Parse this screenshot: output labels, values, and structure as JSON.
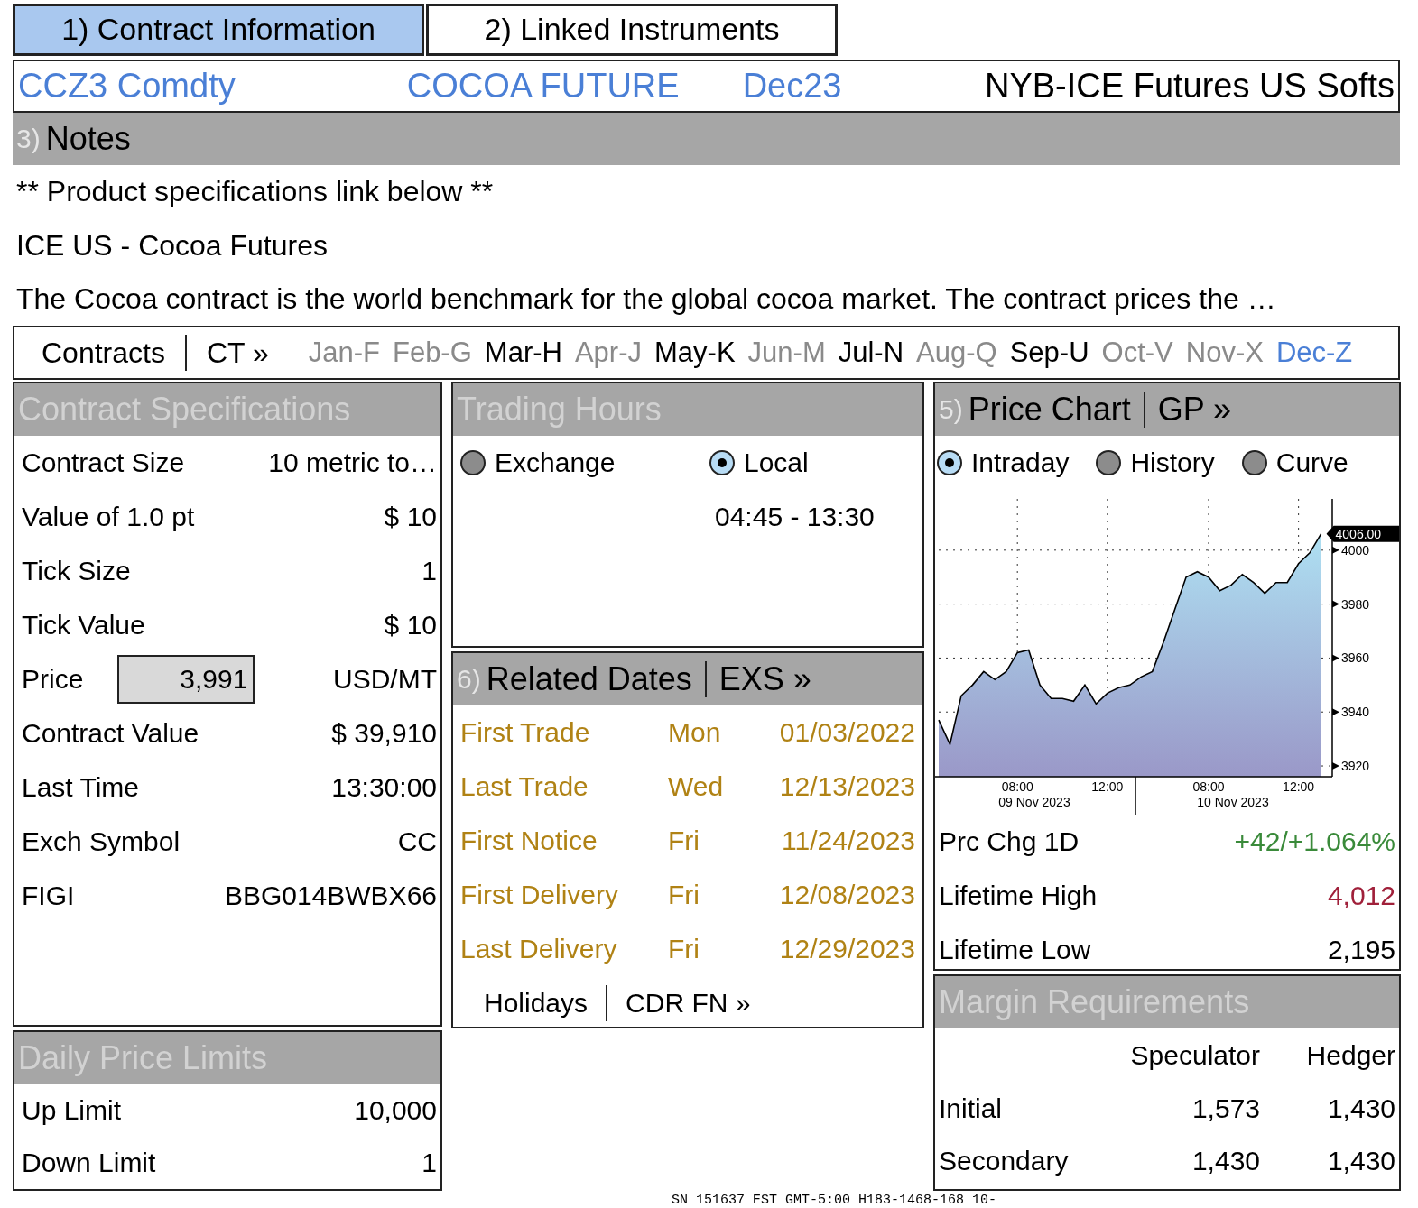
{
  "tabs": [
    {
      "label": "1) Contract Information",
      "selected": true
    },
    {
      "label": "2) Linked Instruments",
      "selected": false
    }
  ],
  "header": {
    "ticker": "CCZ3 Comdty",
    "name": "COCOA FUTURE",
    "month": "Dec23",
    "exchange": "NYB-ICE Futures US Softs"
  },
  "notes": {
    "number": "3)",
    "title": "Notes",
    "lines": [
      "** Product specifications link below **",
      "ICE US - Cocoa Futures",
      "The Cocoa contract is the world benchmark for the global cocoa market. The contract prices the …"
    ]
  },
  "contracts_bar": {
    "label": "Contracts",
    "code": "CT »",
    "months": [
      {
        "label": "Jan-F",
        "available": false,
        "selected": false
      },
      {
        "label": "Feb-G",
        "available": false,
        "selected": false
      },
      {
        "label": "Mar-H",
        "available": true,
        "selected": false
      },
      {
        "label": "Apr-J",
        "available": false,
        "selected": false
      },
      {
        "label": "May-K",
        "available": true,
        "selected": false
      },
      {
        "label": "Jun-M",
        "available": false,
        "selected": false
      },
      {
        "label": "Jul-N",
        "available": true,
        "selected": false
      },
      {
        "label": "Aug-Q",
        "available": false,
        "selected": false
      },
      {
        "label": "Sep-U",
        "available": true,
        "selected": false
      },
      {
        "label": "Oct-V",
        "available": false,
        "selected": false
      },
      {
        "label": "Nov-X",
        "available": false,
        "selected": false
      },
      {
        "label": "Dec-Z",
        "available": true,
        "selected": true
      }
    ]
  },
  "contract_specifications": {
    "title": "Contract Specifications",
    "rows": [
      {
        "kind": "text",
        "label": "Contract Size",
        "value": "10 metric to…"
      },
      {
        "kind": "text",
        "label": "Value of 1.0 pt",
        "value": "$ 10"
      },
      {
        "kind": "text",
        "label": "Tick Size",
        "value": "1"
      },
      {
        "kind": "text",
        "label": "Tick Value",
        "value": "$ 10"
      },
      {
        "kind": "field",
        "label": "Price",
        "value": "3,991",
        "unit": "USD/MT"
      },
      {
        "kind": "text",
        "label": "Contract Value",
        "value": "$ 39,910"
      },
      {
        "kind": "text",
        "label": "Last Time",
        "value": "13:30:00"
      },
      {
        "kind": "text",
        "label": "Exch Symbol",
        "value": "CC"
      },
      {
        "kind": "text",
        "label": "FIGI",
        "value": "BBG014BWBX66"
      }
    ]
  },
  "daily_price_limits": {
    "title": "Daily Price Limits",
    "rows": [
      {
        "label": "Up Limit",
        "value": "10,000"
      },
      {
        "label": "Down Limit",
        "value": "1"
      }
    ]
  },
  "trading_hours": {
    "title": "Trading Hours",
    "options": [
      {
        "label": "Exchange",
        "selected": false
      },
      {
        "label": "Local",
        "selected": true
      }
    ],
    "hours": "04:45 - 13:30"
  },
  "related_dates": {
    "number": "6)",
    "title": "Related Dates",
    "code": "EXS »",
    "rows": [
      {
        "label": "First Trade",
        "day": "Mon",
        "date": "01/03/2022"
      },
      {
        "label": "Last Trade",
        "day": "Wed",
        "date": "12/13/2023"
      },
      {
        "label": "First Notice",
        "day": "Fri",
        "date": "11/24/2023"
      },
      {
        "label": "First Delivery",
        "day": "Fri",
        "date": "12/08/2023"
      },
      {
        "label": "Last Delivery",
        "day": "Fri",
        "date": "12/29/2023"
      }
    ],
    "footer": {
      "label": "Holidays",
      "code": "CDR FN »"
    }
  },
  "price_chart": {
    "number": "5)",
    "title": "Price Chart",
    "code": "GP »",
    "modes": [
      {
        "label": "Intraday",
        "selected": true
      },
      {
        "label": "History",
        "selected": false
      },
      {
        "label": "Curve",
        "selected": false
      }
    ],
    "date_labels": [
      "09 Nov 2023",
      "10 Nov 2023"
    ],
    "chart_data": {
      "type": "area",
      "categories": [
        null,
        null,
        null,
        null,
        null,
        null,
        null,
        "08:00",
        null,
        null,
        null,
        null,
        null,
        null,
        null,
        "12:00",
        null,
        null,
        null,
        null,
        null,
        null,
        null,
        null,
        "08:00",
        null,
        null,
        null,
        null,
        null,
        null,
        null,
        "12:00",
        null,
        null
      ],
      "series": [
        {
          "color": "#000000",
          "values": [
            3937,
            3928,
            3946,
            3950,
            3955,
            3952,
            3955,
            3962,
            3963,
            3950,
            3945,
            3945,
            3944,
            3950,
            3943,
            3947,
            3949,
            3950,
            3953,
            3955,
            3966,
            3978,
            3990,
            3992,
            3990,
            3985,
            3987,
            3991,
            3988,
            3984,
            3988,
            3988,
            3995,
            3999,
            4006
          ]
        }
      ],
      "ylim": [
        3916,
        4019
      ],
      "yticks": [
        3920,
        3940,
        3960,
        3980,
        4000
      ],
      "grid": true,
      "annotations": [
        "4006.00"
      ]
    },
    "stats": [
      {
        "label": "Prc Chg 1D",
        "value": "+42/+1.064%",
        "color": "#3a8a3a"
      },
      {
        "label": "Lifetime High",
        "value": "4,012",
        "color": "#a0203a"
      },
      {
        "label": "Lifetime Low",
        "value": "2,195",
        "color": "#000000"
      }
    ]
  },
  "margin_requirements": {
    "title": "Margin Requirements",
    "columns": [
      "Speculator",
      "Hedger"
    ],
    "rows": [
      {
        "label": "Initial",
        "values": [
          "1,573",
          "1,430"
        ]
      },
      {
        "label": "Secondary",
        "values": [
          "1,430",
          "1,430"
        ]
      }
    ]
  },
  "footer": "SN 151637 EST  GMT-5:00 H183-1468-168 10-"
}
